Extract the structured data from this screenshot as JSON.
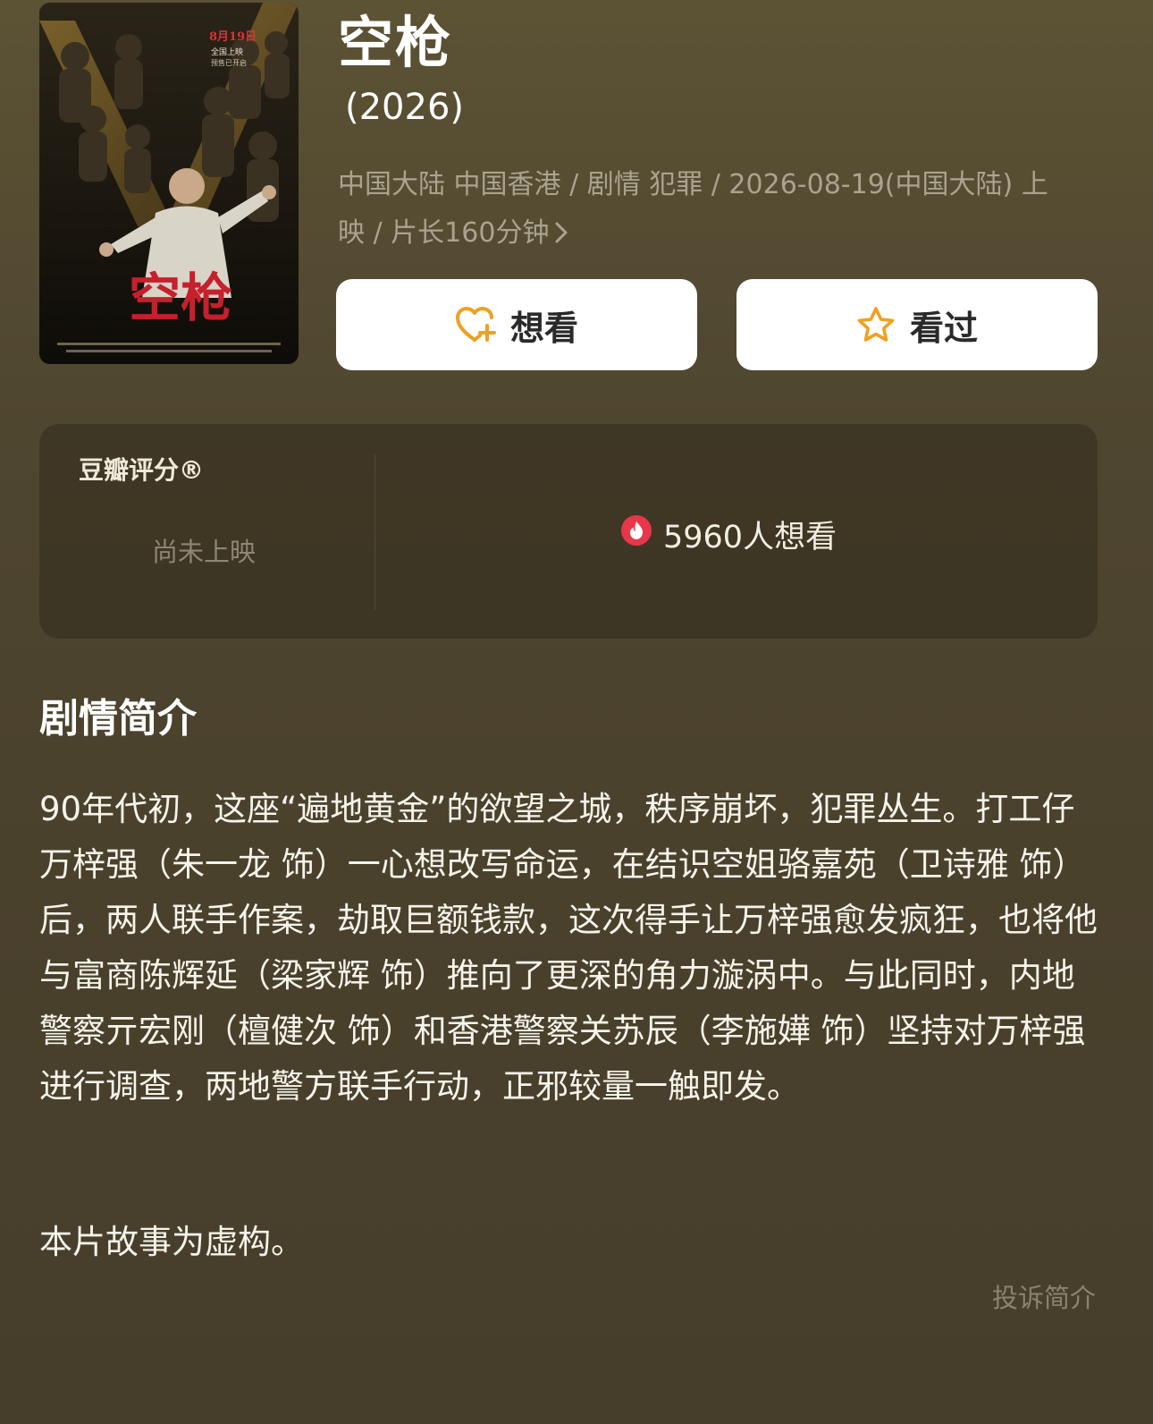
{
  "movie": {
    "title": "空枪",
    "year": "(2026)",
    "meta_line1": "中国大陆 中国香港 / 剧情 犯罪 / 2026-08-19(中国大陆) 上",
    "meta_line2": "映 / 片长160分钟",
    "poster": {
      "date_text": "8月19日",
      "release_text": "全国上映",
      "presale_text": "预售已开启",
      "title_art": "空枪"
    }
  },
  "actions": {
    "want_label": "想看",
    "seen_label": "看过"
  },
  "rating": {
    "label": "豆瓣评分®",
    "status": "尚未上映",
    "wish_count": "5960人想看"
  },
  "synopsis": {
    "heading": "剧情简介",
    "body": "90年代初，这座“遍地黄金”的欲望之城，秩序崩坏，犯罪丛生。打工仔万梓强（朱一龙 饰）一心想改写命运，在结识空姐骆嘉苑（卫诗雅 饰）后，两人联手作案，劫取巨额钱款，这次得手让万梓强愈发疯狂，也将他与富商陈辉延（梁家辉 饰）推向了更深的角力漩涡中。与此同时，内地警察亓宏刚（檀健次 饰）和香港警察关苏辰（李施嬅 饰）坚持对万梓强进行调查，两地警方联手行动，正邪较量一触即发。",
    "note": "本片故事为虚构。",
    "report_label": "投诉简介"
  },
  "colors": {
    "background": "#4f4630",
    "accent_orange": "#f0a020",
    "wish_red": "#e8364a",
    "muted_text": "#aaa38f"
  }
}
